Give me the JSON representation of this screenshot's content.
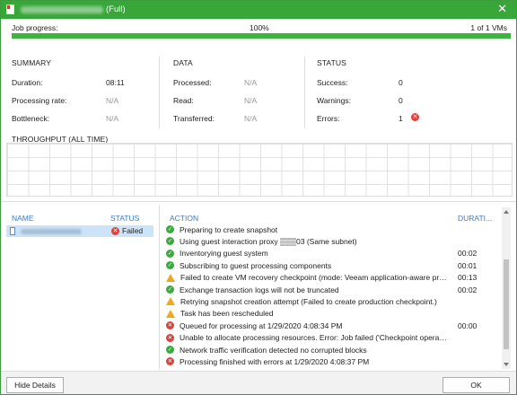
{
  "window": {
    "title": "(Full)",
    "close_glyph": "✕",
    "icon": "document-icon"
  },
  "progress": {
    "label": "Job progress:",
    "percent_text": "100%",
    "value": 1.0,
    "vms_text": "1 of 1 VMs",
    "color": "#3db43f"
  },
  "summary": {
    "heading": "SUMMARY",
    "items": [
      {
        "label": "Duration:",
        "value": "08:11"
      },
      {
        "label": "Processing rate:",
        "value": "N/A"
      },
      {
        "label": "Bottleneck:",
        "value": "N/A"
      }
    ]
  },
  "data_section": {
    "heading": "DATA",
    "items": [
      {
        "label": "Processed:",
        "value": "N/A"
      },
      {
        "label": "Read:",
        "value": "N/A"
      },
      {
        "label": "Transferred:",
        "value": "N/A"
      }
    ]
  },
  "status_section": {
    "heading": "STATUS",
    "items": [
      {
        "label": "Success:",
        "value": "0"
      },
      {
        "label": "Warnings:",
        "value": "0"
      },
      {
        "label": "Errors:",
        "value": "1"
      }
    ]
  },
  "throughput": {
    "heading": "THROUGHPUT (ALL TIME)"
  },
  "vm_table": {
    "columns": {
      "name": "NAME",
      "status": "STATUS"
    },
    "rows": [
      {
        "status": "Failed",
        "status_icon": "error-icon"
      }
    ]
  },
  "action_table": {
    "columns": {
      "action": "ACTION",
      "duration": "DURATI..."
    },
    "rows": [
      {
        "icon": "success",
        "text": "Preparing to create snapshot",
        "duration": ""
      },
      {
        "icon": "success",
        "text": "Using guest interaction proxy ▒▒▒03 (Same subnet)",
        "duration": ""
      },
      {
        "icon": "success",
        "text": "Inventorying guest system",
        "duration": "00:02"
      },
      {
        "icon": "success",
        "text": "Subscribing to guest processing components",
        "duration": "00:01"
      },
      {
        "icon": "warning",
        "text": "Failed to create VM recovery checkpoint (mode: Veeam application-aware proc...",
        "duration": "00:13"
      },
      {
        "icon": "success",
        "text": "Exchange transaction logs will not be truncated",
        "duration": "00:02"
      },
      {
        "icon": "warning",
        "text": "Retrying snapshot creation attempt (Failed to create production checkpoint.)",
        "duration": ""
      },
      {
        "icon": "warning",
        "text": "Task has been rescheduled",
        "duration": ""
      },
      {
        "icon": "error",
        "text": "Queued for processing at 1/29/2020 4:08:34 PM",
        "duration": "00:00"
      },
      {
        "icon": "error",
        "text": "Unable to allocate processing resources. Error: Job failed ('Checkpoint operatio...",
        "duration": ""
      },
      {
        "icon": "success",
        "text": "Network traffic verification detected no corrupted blocks",
        "duration": ""
      },
      {
        "icon": "error",
        "text": "Processing finished with errors at 1/29/2020 4:08:37 PM",
        "duration": ""
      }
    ]
  },
  "footer": {
    "hide_details": "Hide Details",
    "ok": "OK"
  },
  "colors": {
    "title_bar": "#36a738",
    "header_link": "#3a7ac8",
    "selected_row": "#cde3f8",
    "error": "#e0403a",
    "warning": "#f0a81e",
    "success": "#3aaa3d"
  }
}
